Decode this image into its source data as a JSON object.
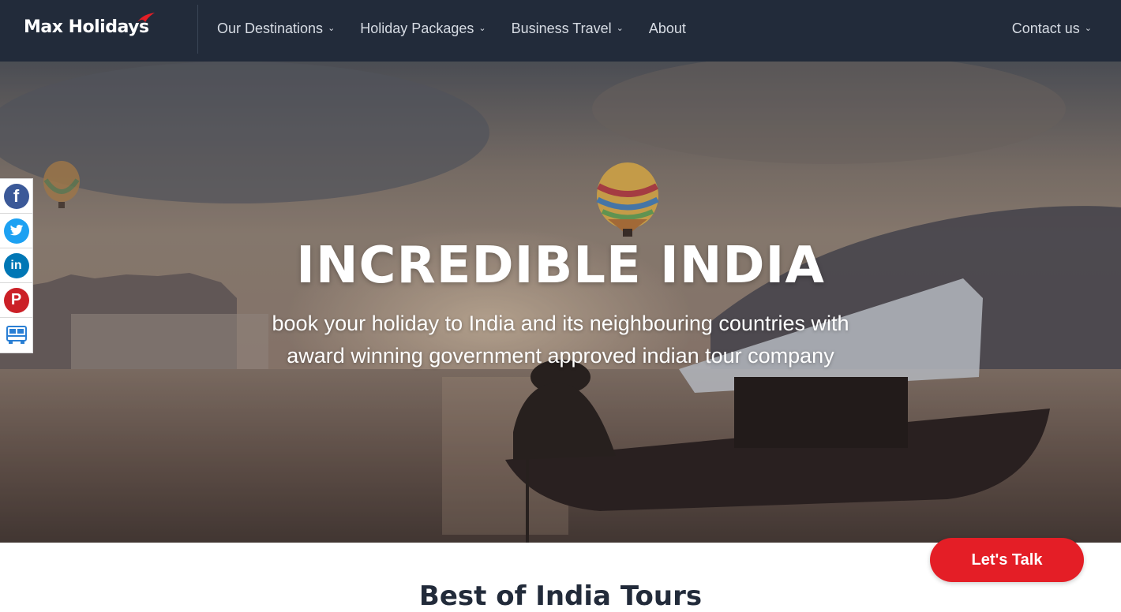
{
  "header": {
    "brand": "Max Holidays",
    "nav": [
      {
        "label": "Our Destinations",
        "dropdown": true
      },
      {
        "label": "Holiday Packages",
        "dropdown": true
      },
      {
        "label": "Business Travel",
        "dropdown": true
      },
      {
        "label": "About",
        "dropdown": false
      }
    ],
    "contact": {
      "label": "Contact us",
      "dropdown": true
    }
  },
  "hero": {
    "title": "INCREDIBLE INDIA",
    "subtitle_line1": "book your holiday to India and its neighbouring countries with",
    "subtitle_line2": "award winning government approved indian tour company"
  },
  "social": [
    {
      "name": "facebook-icon",
      "glyph": "f",
      "color": "#3b5998"
    },
    {
      "name": "twitter-icon",
      "glyph": "t",
      "color": "#1da1f2"
    },
    {
      "name": "linkedin-icon",
      "glyph": "in",
      "color": "#0077b5"
    },
    {
      "name": "pinterest-icon",
      "glyph": "P",
      "color": "#cb2027"
    },
    {
      "name": "bus-icon",
      "glyph": "",
      "color": "#2a7fd4"
    }
  ],
  "section": {
    "title": "Best of India Tours"
  },
  "cta": {
    "label": "Let's Talk"
  },
  "colors": {
    "nav_bg": "#222b3a",
    "accent": "#e41e26"
  }
}
